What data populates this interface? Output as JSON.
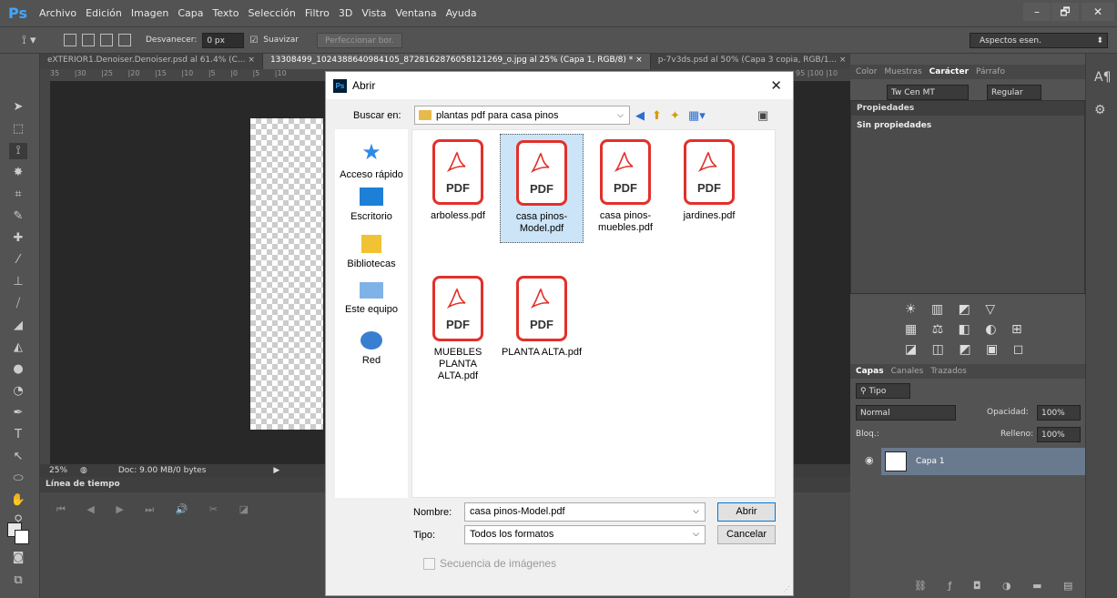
{
  "app": {
    "logo": "Ps",
    "menu": [
      "Archivo",
      "Edición",
      "Imagen",
      "Capa",
      "Texto",
      "Selección",
      "Filtro",
      "3D",
      "Vista",
      "Ventana",
      "Ayuda"
    ],
    "window_controls": {
      "minimize": "–",
      "maximize": "🗗",
      "close": "✕"
    }
  },
  "options_bar": {
    "feather_label": "Desvanecer:",
    "feather_value": "0 px",
    "antialias_label": "Suavizar",
    "refine_label": "Perfeccionar bor.",
    "workspace": "Aspectos esen."
  },
  "doc_tabs": [
    "eXTERIOR1.Denoiser.Denoiser.psd al 61.4% (C... ×",
    "13308499_1024388640984105_8728162876058121269_o.jpg al 25% (Capa 1, RGB/8) * ×",
    "p-7v3ds.psd al 50% (Capa 3 copia, RGB/1... ×"
  ],
  "ruler_ticks": "35 |30 |25 |20 |15 |10 |5 |0 |5 |10",
  "ruler_ticks_right": "95 |100 |10",
  "status": {
    "zoom": "25%",
    "doc": "Doc: 9.00 MB/0 bytes"
  },
  "timeline": {
    "title": "Línea de tiempo"
  },
  "right_panel": {
    "char_tabs": [
      "Color",
      "Muestras",
      "Carácter",
      "Párrafo"
    ],
    "font": "Tw Cen MT",
    "style": "Regular",
    "props_title": "Propiedades",
    "props_empty": "Sin propiedades",
    "layers_tabs": [
      "Capas",
      "Canales",
      "Trazados"
    ],
    "filter": "Tipo",
    "blend": "Normal",
    "opacity_label": "Opacidad:",
    "opacity": "100%",
    "lock_label": "Bloq.:",
    "fill_label": "Relleno:",
    "fill": "100%",
    "layer_name": "Capa 1"
  },
  "dialog": {
    "title": "Abrir",
    "lookin_label": "Buscar en:",
    "lookin_value": "plantas pdf para casa pinos",
    "places": [
      "Acceso rápido",
      "Escritorio",
      "Bibliotecas",
      "Este equipo",
      "Red"
    ],
    "files": [
      "arboless.pdf",
      "casa pinos-Model.pdf",
      "casa pinos-muebles.pdf",
      "jardines.pdf",
      "MUEBLES PLANTA ALTA.pdf",
      "PLANTA ALTA.pdf"
    ],
    "selected_file": "casa pinos-Model.pdf",
    "pdf_badge": "PDF",
    "name_label": "Nombre:",
    "name_value": "casa pinos-Model.pdf",
    "type_label": "Tipo:",
    "type_value": "Todos los formatos",
    "open_button": "Abrir",
    "cancel_button": "Cancelar",
    "sequence_label": "Secuencia de imágenes"
  }
}
